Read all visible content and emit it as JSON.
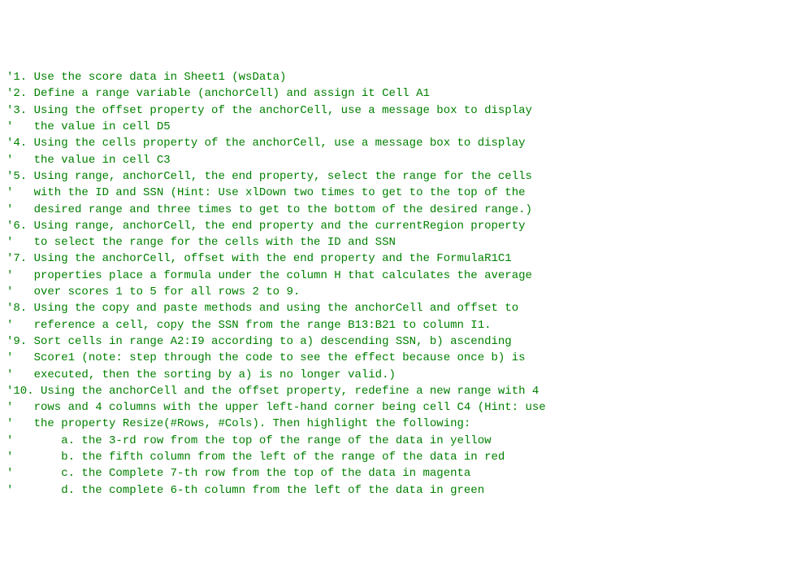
{
  "lines": [
    "'1. Use the score data in Sheet1 (wsData)",
    "'2. Define a range variable (anchorCell) and assign it Cell A1",
    "'3. Using the offset property of the anchorCell, use a message box to display",
    "'   the value in cell D5",
    "'4. Using the cells property of the anchorCell, use a message box to display",
    "'   the value in cell C3",
    "'5. Using range, anchorCell, the end property, select the range for the cells",
    "'   with the ID and SSN (Hint: Use xlDown two times to get to the top of the",
    "'   desired range and three times to get to the bottom of the desired range.)",
    "'6. Using range, anchorCell, the end property and the currentRegion property",
    "'   to select the range for the cells with the ID and SSN",
    "'7. Using the anchorCell, offset with the end property and the FormulaR1C1",
    "'   properties place a formula under the column H that calculates the average",
    "'   over scores 1 to 5 for all rows 2 to 9.",
    "'8. Using the copy and paste methods and using the anchorCell and offset to",
    "'   reference a cell, copy the SSN from the range B13:B21 to column I1.",
    "'9. Sort cells in range A2:I9 according to a) descending SSN, b) ascending",
    "'   Score1 (note: step through the code to see the effect because once b) is",
    "'   executed, then the sorting by a) is no longer valid.)",
    "'10. Using the anchorCell and the offset property, redefine a new range with 4",
    "'   rows and 4 columns with the upper left-hand corner being cell C4 (Hint: use",
    "'   the property Resize(#Rows, #Cols). Then highlight the following:",
    "'       a. the 3-rd row from the top of the range of the data in yellow",
    "'       b. the fifth column from the left of the range of the data in red",
    "'       c. the Complete 7-th row from the top of the data in magenta",
    "'       d. the complete 6-th column from the left of the data in green"
  ]
}
